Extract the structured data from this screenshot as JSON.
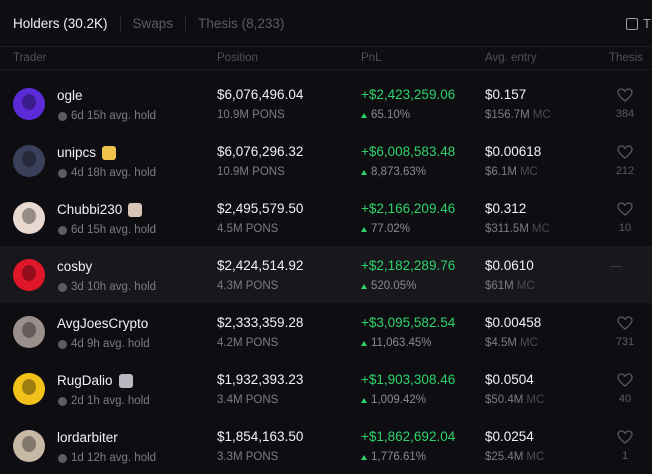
{
  "tabs": [
    {
      "label": "Holders (30.2K)"
    },
    {
      "label": "Swaps"
    },
    {
      "label": "Thesis (8,233)"
    }
  ],
  "toggle_label": "T",
  "columns": {
    "trader": "Trader",
    "position": "Position",
    "pnl": "PnL",
    "avg_entry": "Avg. entry",
    "thesis": "Thesis"
  },
  "mc_label": "MC",
  "rows": [
    {
      "name": "ogle",
      "hold": "6d 15h avg. hold",
      "position": "$6,076,496.04",
      "position_sub": "10.9M PONS",
      "pnl": "+$2,423,259.06",
      "pnl_pct": "65.10%",
      "entry": "$0.157",
      "entry_mc": "$156.7M",
      "likes": "384",
      "avatar_color": "#5b2bd8",
      "badge": ""
    },
    {
      "name": "unipcs",
      "hold": "4d 18h avg. hold",
      "position": "$6,076,296.32",
      "position_sub": "10.9M PONS",
      "pnl": "+$6,008,583.48",
      "pnl_pct": "8,873.63%",
      "entry": "$0.00618",
      "entry_mc": "$6.1M",
      "likes": "212",
      "avatar_color": "#3a3f5a",
      "badge": "smiley"
    },
    {
      "name": "Chubbi230",
      "hold": "6d 15h avg. hold",
      "position": "$2,495,579.50",
      "position_sub": "4.5M PONS",
      "pnl": "+$2,166,209.46",
      "pnl_pct": "77.02%",
      "entry": "$0.312",
      "entry_mc": "$311.5M",
      "likes": "10",
      "avatar_color": "#e8d8d0",
      "badge": "portrait"
    },
    {
      "name": "cosby",
      "hold": "3d 10h avg. hold",
      "position": "$2,424,514.92",
      "position_sub": "4.3M PONS",
      "pnl": "+$2,182,289.76",
      "pnl_pct": "520.05%",
      "entry": "$0.0610",
      "entry_mc": "$61M",
      "likes": "",
      "avatar_color": "#e0162b",
      "badge": ""
    },
    {
      "name": "AvgJoesCrypto",
      "hold": "4d 9h avg. hold",
      "position": "$2,333,359.28",
      "position_sub": "4.2M PONS",
      "pnl": "+$3,095,582.54",
      "pnl_pct": "11,063.45%",
      "entry": "$0.00458",
      "entry_mc": "$4.5M",
      "likes": "731",
      "avatar_color": "#9a8f8a",
      "badge": ""
    },
    {
      "name": "RugDalio",
      "hold": "2d 1h avg. hold",
      "position": "$1,932,393.23",
      "position_sub": "3.4M PONS",
      "pnl": "+$1,903,308.46",
      "pnl_pct": "1,009.42%",
      "entry": "$0.0504",
      "entry_mc": "$50.4M",
      "likes": "40",
      "avatar_color": "#f2c21a",
      "badge": "figure"
    },
    {
      "name": "lordarbiter",
      "hold": "1d 12h avg. hold",
      "position": "$1,854,163.50",
      "position_sub": "3.3M PONS",
      "pnl": "+$1,862,692.04",
      "pnl_pct": "1,776.61%",
      "entry": "$0.0254",
      "entry_mc": "$25.4M",
      "likes": "1",
      "avatar_color": "#c8b9a6",
      "badge": ""
    }
  ]
}
